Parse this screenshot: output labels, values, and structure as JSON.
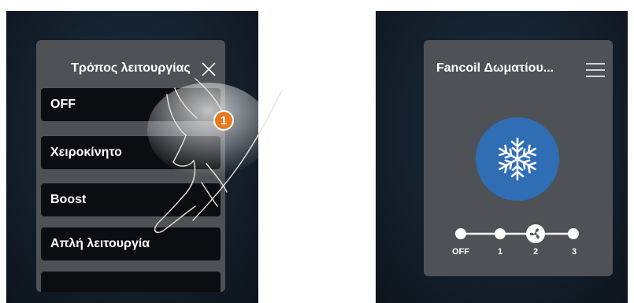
{
  "left_screen": {
    "title": "Τρόπος λειτουργίας",
    "close_icon": "close-icon",
    "modes": [
      "OFF",
      "Χειροκίνητο",
      "Boost",
      "Απλή λειτουργία"
    ]
  },
  "right_screen": {
    "title": "Fancoil Δωματίου...",
    "menu_icon": "hamburger-menu-icon",
    "mode_icon": "snowflake-icon",
    "fan_speed": {
      "labels": [
        "OFF",
        "1",
        "2",
        "3"
      ],
      "selected": "2",
      "selected_icon": "fan-icon"
    }
  },
  "annotation": {
    "step_number": "1",
    "pointer": "hand-pointer"
  },
  "colors": {
    "panel_bg": "#4e5257",
    "item_bg": "#0b0e11",
    "snow_circle": "#2f6eb5",
    "step_badge": "#e7781f"
  }
}
